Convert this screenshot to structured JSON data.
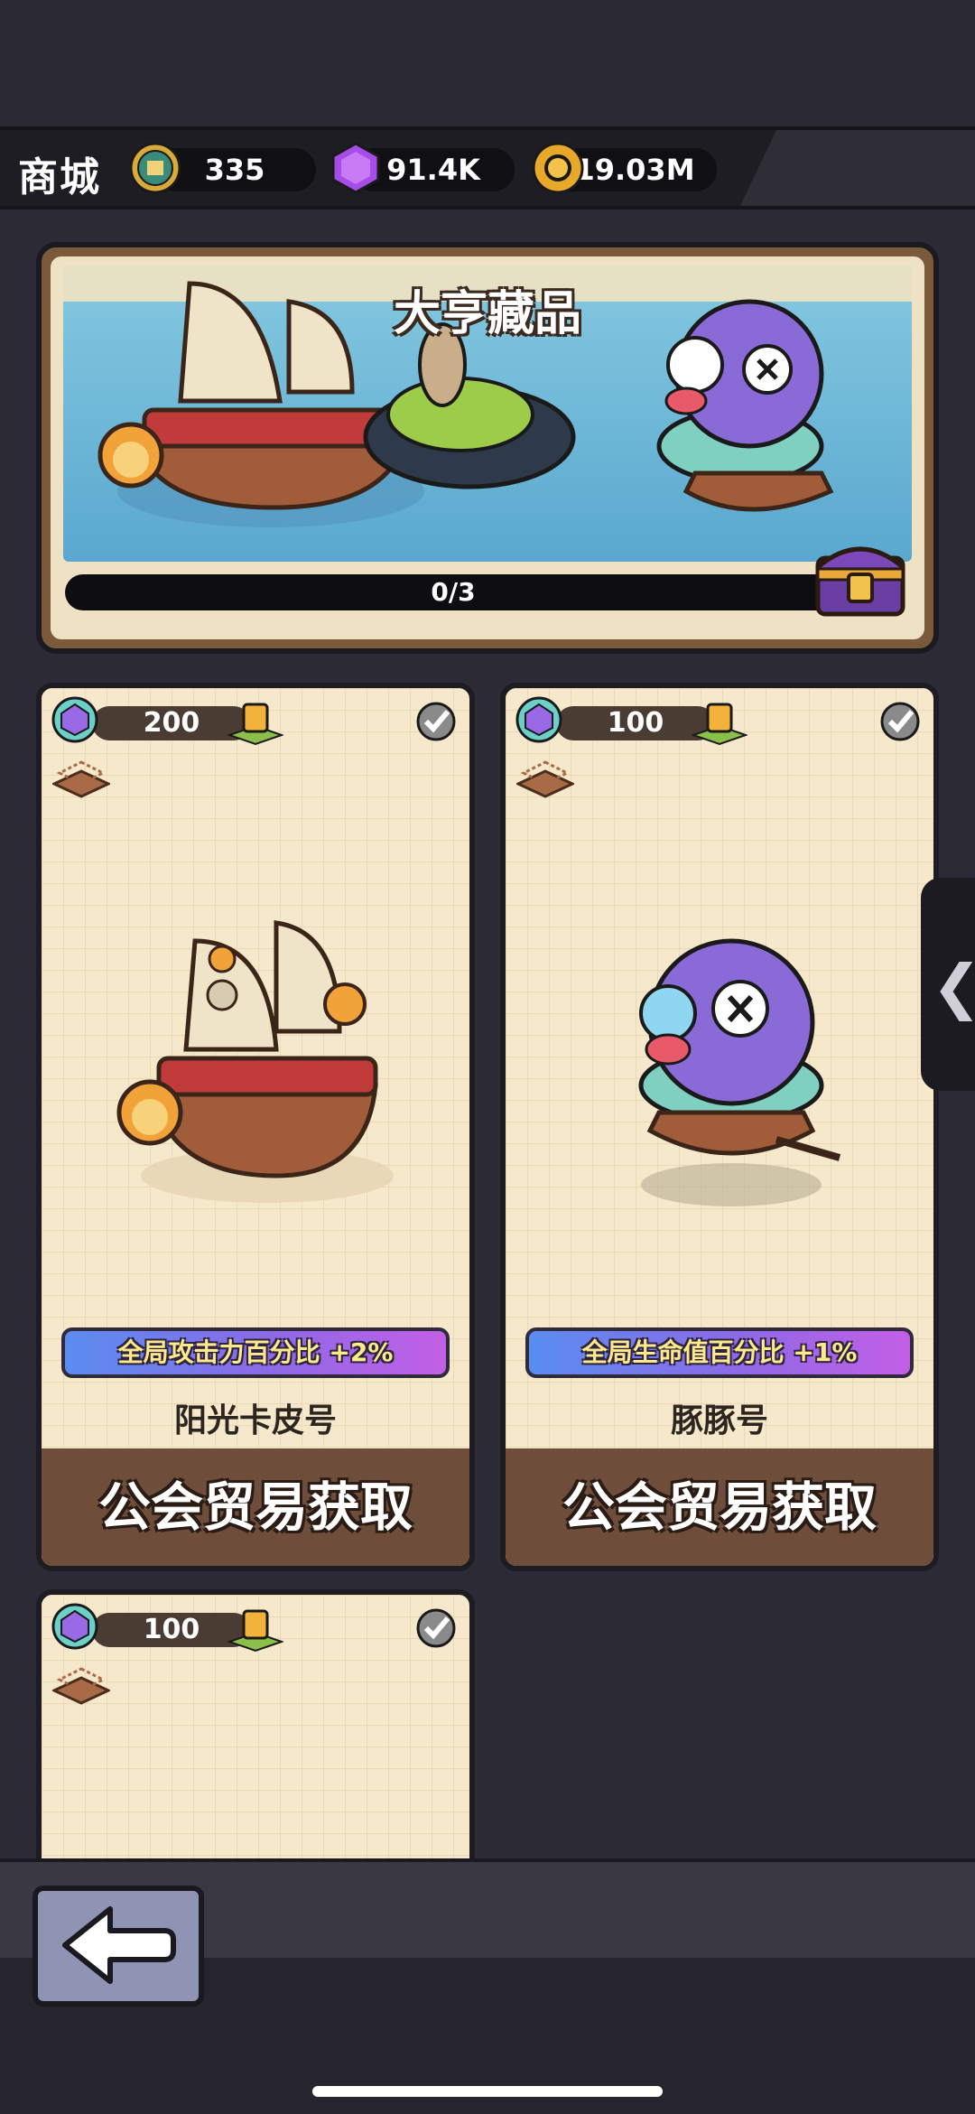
{
  "header": {
    "title": "商城",
    "currencies": [
      {
        "icon": "guild-coin-icon",
        "value": "335"
      },
      {
        "icon": "purple-gem-icon",
        "value": "91.4K"
      },
      {
        "icon": "gold-coin-icon",
        "value": "19.03M"
      }
    ]
  },
  "banner": {
    "title": "大亨藏品",
    "progress_text": "0/3",
    "progress": 0
  },
  "cards": [
    {
      "price": "200",
      "stat": "全局攻击力百分比 +2%",
      "name": "阳光卡皮号",
      "action": "公会贸易获取"
    },
    {
      "price": "100",
      "stat": "全局生命值百分比 +1%",
      "name": "豚豚号",
      "action": "公会贸易获取"
    },
    {
      "price": "100"
    }
  ],
  "colors": {
    "accent_purple": "#8e69e6",
    "brown_bar": "#6e4e3a",
    "card_bg": "#f6e8cb"
  }
}
